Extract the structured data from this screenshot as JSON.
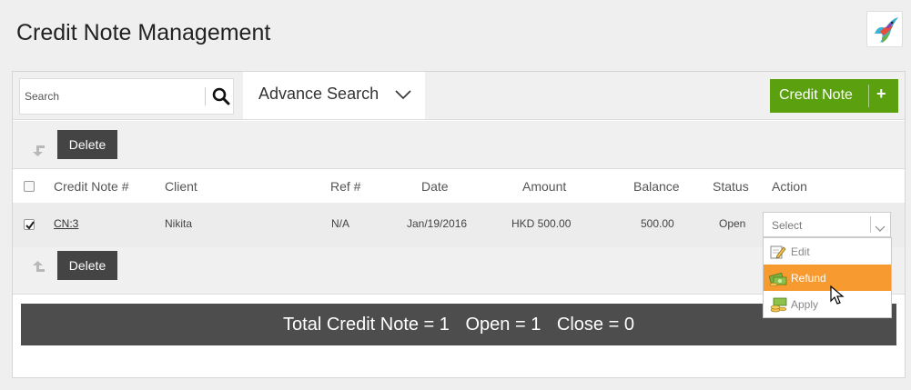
{
  "page": {
    "title": "Credit Note Management"
  },
  "search": {
    "placeholder": "Search"
  },
  "advance_search": {
    "label": "Advance Search"
  },
  "credit_note_button": {
    "label": "Credit Note",
    "plus": "+"
  },
  "delete_label": "Delete",
  "table": {
    "headers": [
      "Credit Note #",
      "Client",
      "Ref #",
      "Date",
      "Amount",
      "Balance",
      "Status",
      "Action"
    ],
    "rows": [
      {
        "checked": true,
        "credit_note": "CN:3",
        "client": "Nikita",
        "ref": "N/A",
        "date": "Jan/19/2016",
        "amount": "HKD 500.00",
        "balance": "500.00",
        "status": "Open",
        "action_placeholder": "Select"
      }
    ]
  },
  "action_menu": {
    "items": [
      {
        "label": "Edit",
        "icon": "edit-icon",
        "active": false
      },
      {
        "label": "Refund",
        "icon": "money-icon",
        "active": true
      },
      {
        "label": "Apply",
        "icon": "coins-icon",
        "active": false
      }
    ]
  },
  "summary": {
    "total": "Total Credit Note = 1",
    "open": "Open = 1",
    "close": "Close = 0"
  },
  "colors": {
    "primary_green": "#5aa00f",
    "dark_button": "#444444",
    "highlight_orange": "#f79a30",
    "summary_bar": "#4d4d4d"
  }
}
